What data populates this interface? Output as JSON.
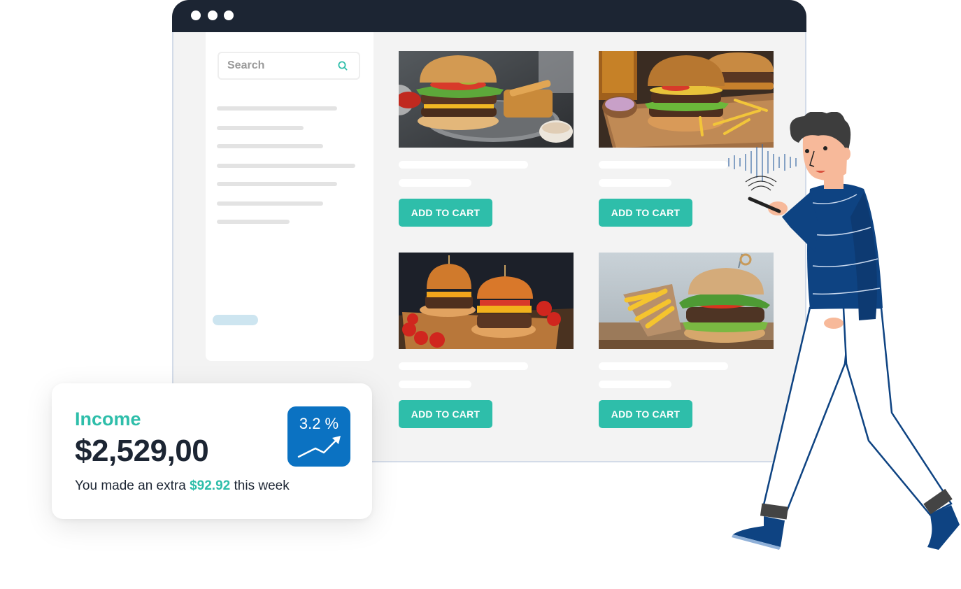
{
  "browser": {
    "window_controls": [
      "dot",
      "dot",
      "dot"
    ],
    "search": {
      "placeholder": "Search",
      "value": "",
      "icon": "search-icon"
    },
    "sidebar_placeholder_lines": 7
  },
  "products": [
    {
      "image": "burger-plate-with-fries",
      "button_label": "ADD TO CART"
    },
    {
      "image": "burgers-on-wooden-board",
      "button_label": "ADD TO CART"
    },
    {
      "image": "two-burgers-with-tomatoes",
      "button_label": "ADD TO CART"
    },
    {
      "image": "burger-with-fries-in-paper",
      "button_label": "ADD TO CART"
    }
  ],
  "income_card": {
    "label": "Income",
    "amount": "$2,529,00",
    "note_prefix": "You made an extra",
    "note_value": "$92.92",
    "note_suffix": "this week",
    "badge": {
      "percent": "3.2 %",
      "icon": "trend-up-icon"
    }
  },
  "colors": {
    "accent": "#2ebeaa",
    "titlebar": "#1c2533",
    "badge": "#0b72c2",
    "sweater": "#0e4382"
  }
}
